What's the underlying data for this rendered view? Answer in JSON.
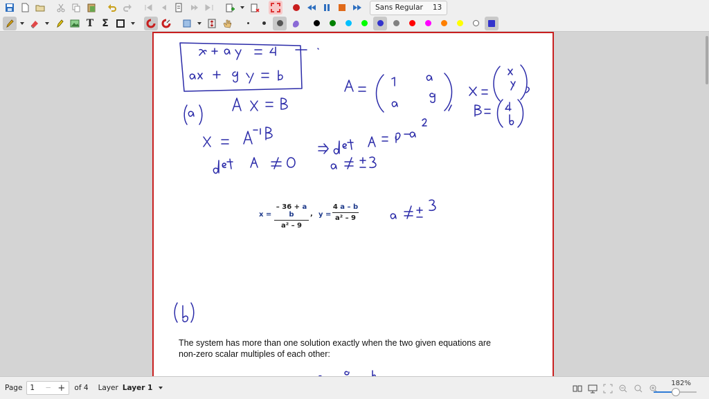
{
  "toolbar": {
    "font": {
      "name": "Sans Regular",
      "size": "13"
    },
    "pen_colors": [
      "#000000",
      "#008000",
      "#00c0ff",
      "#00ff00",
      "#3333cc",
      "#808080",
      "#ff0000",
      "#ff00ff",
      "#ff8000",
      "#ffff00",
      "#ffffff",
      "#3333cc"
    ]
  },
  "document": {
    "typed": {
      "x_label": "x =",
      "x_num_a": "– 36 +",
      "x_num_b": "a b",
      "x_den": "a² – 9",
      "sep": ",",
      "y_label": "y =",
      "y_num_a": "4",
      "y_num_b": "a – b",
      "y_den": "a² – 9"
    },
    "paragraph_line1": "The system has more than one solution exactly when the two given equations are",
    "paragraph_line2": "non-zero scalar multiples of each other:",
    "ink_color": "#2a2aa8"
  },
  "statusbar": {
    "page_label": "Page",
    "page_value": "1",
    "of_pages": "of 4",
    "layer_label": "Layer",
    "layer_value": "Layer 1",
    "zoom": "182%",
    "zoom_fraction": 0.5
  }
}
